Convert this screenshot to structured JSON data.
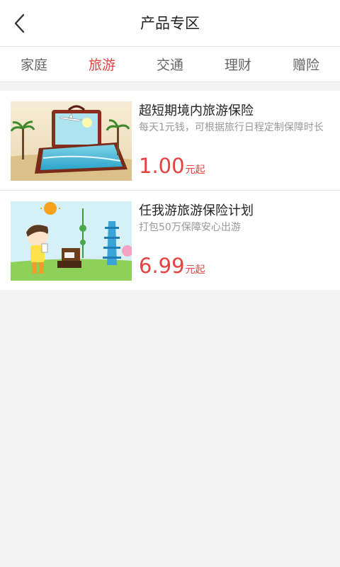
{
  "header": {
    "title": "产品专区",
    "back_icon": "chevron-left-icon"
  },
  "tabs": [
    {
      "label": "家庭",
      "active": false
    },
    {
      "label": "旅游",
      "active": true
    },
    {
      "label": "交通",
      "active": false
    },
    {
      "label": "理财",
      "active": false
    },
    {
      "label": "赠险",
      "active": false
    }
  ],
  "products": [
    {
      "title": "超短期境内旅游保险",
      "desc": "每天1元钱，可根据旅行日程定制保障时长",
      "price": "1.00",
      "unit": "元起",
      "image": "suitcase-beach-travel-image"
    },
    {
      "title": "任我游旅游保险计划",
      "desc": "打包50万保障安心出游",
      "price": "6.99",
      "unit": "元起",
      "image": "cartoon-traveler-landmarks-image"
    }
  ],
  "colors": {
    "accent": "#e64340",
    "page_bg": "#f4f4f4",
    "text_primary": "#222222",
    "text_secondary": "#999999"
  }
}
